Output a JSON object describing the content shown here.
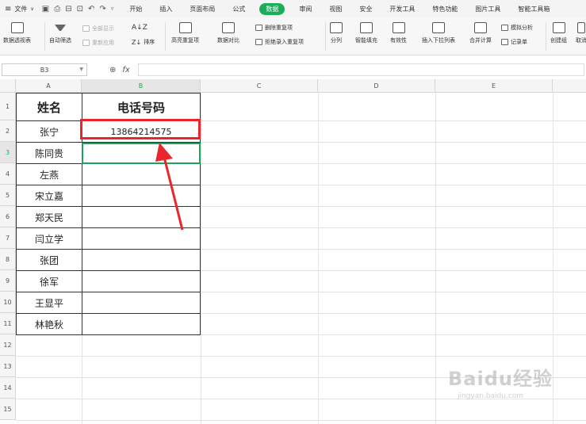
{
  "menubar": {
    "file_label": "文件",
    "file_dropdown": "∨",
    "tabs": [
      "开始",
      "插入",
      "页面布局",
      "公式",
      "数据",
      "审阅",
      "视图",
      "安全",
      "开发工具",
      "特色功能",
      "图片工具",
      "智能工具箱"
    ],
    "active_tab": "数据"
  },
  "ribbon": {
    "pivot": "数据透视表",
    "autofilter": "自动筛选",
    "show_all": "全部显示",
    "reapply": "重新应用",
    "sort": "排序",
    "highlight_dup": "高亮重复项",
    "data_compare": "数据对比",
    "remove_dup": "删除重复项",
    "reject_dup": "拒绝录入重复项",
    "split": "分列",
    "smart_fill": "智能填充",
    "validity": "有效性",
    "insert_dropdown": "插入下拉列表",
    "consolidate": "合并计算",
    "whatif": "模拟分析",
    "record": "记录单",
    "create_group": "创建组",
    "cancel_group": "取消"
  },
  "formula_bar": {
    "name_box": "B3",
    "fx_label": "fx",
    "zoom_icon": "⊕",
    "value": ""
  },
  "sheet": {
    "columns": [
      "A",
      "B",
      "C",
      "D",
      "E"
    ],
    "rows": [
      "1",
      "2",
      "3",
      "4",
      "5",
      "6",
      "7",
      "8",
      "9",
      "10",
      "11",
      "12",
      "13",
      "14",
      "15"
    ],
    "header_name": "姓名",
    "header_phone": "电话号码",
    "names": [
      "张宁",
      "陈同贵",
      "左燕",
      "宋立嘉",
      "郑天民",
      "闫立学",
      "张团",
      "徐军",
      "王显平",
      "林艳秋"
    ],
    "phones": [
      "13864214575",
      "",
      "",
      "",
      "",
      "",
      "",
      "",
      "",
      ""
    ]
  },
  "watermark": {
    "logo": "Baidu经验",
    "url": "jingyan.baidu.com"
  },
  "colors": {
    "accent": "#1aad5b",
    "highlight_box": "#e8262b",
    "active_cell": "#1aa35a"
  }
}
